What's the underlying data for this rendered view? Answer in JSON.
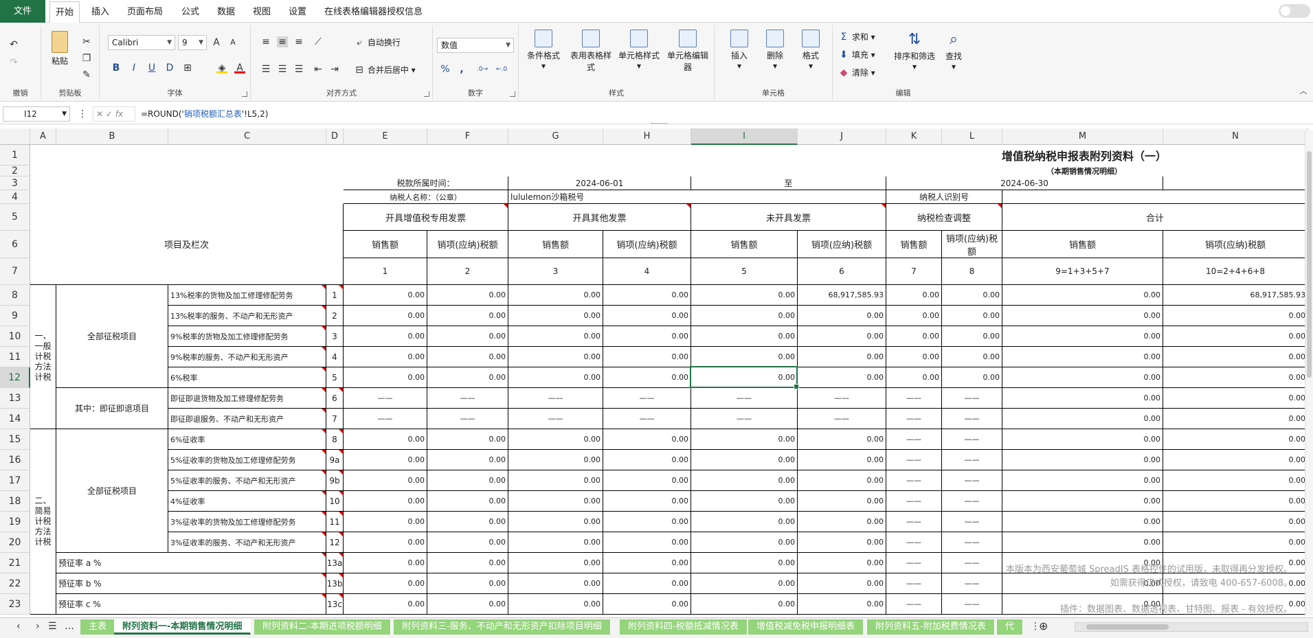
{
  "menu": {
    "file": "文件",
    "items": [
      "开始",
      "插入",
      "页面布局",
      "公式",
      "数据",
      "视图",
      "设置",
      "在线表格编辑器授权信息"
    ]
  },
  "ribbon": {
    "undo_group": "撤销",
    "clipboard": {
      "paste": "粘贴",
      "label": "剪贴板"
    },
    "font": {
      "name": "Calibri",
      "size": "9",
      "label": "字体",
      "bold": "B",
      "italic": "I",
      "underline": "U"
    },
    "align": {
      "wrap": "自动换行",
      "merge": "合并后居中",
      "label": "对齐方式"
    },
    "number": {
      "format": "数值",
      "label": "数字",
      "percent": "%",
      "comma": ","
    },
    "styles": {
      "cond": "条件格式",
      "table": "表用表格样式",
      "cell": "单元格样式",
      "editor": "单元格编辑器",
      "label": "样式"
    },
    "cells": {
      "insert": "插入",
      "delete": "删除",
      "format": "格式",
      "label": "单元格"
    },
    "edit": {
      "sum": "求和",
      "fill": "填充",
      "clear": "清除",
      "sort": "排序和筛选",
      "find": "查找",
      "label": "编辑"
    }
  },
  "formula_bar": {
    "name": "I12",
    "fx": "fx",
    "formula_pre": "=ROUND('",
    "formula_ref": "销项税额汇总表",
    "formula_post": "'!L5,2)"
  },
  "columns": [
    "A",
    "B",
    "C",
    "D",
    "E",
    "F",
    "G",
    "H",
    "I",
    "J",
    "K",
    "L",
    "M",
    "N"
  ],
  "rows": [
    "1",
    "2",
    "3",
    "4",
    "5",
    "6",
    "7",
    "8",
    "9",
    "10",
    "11",
    "12",
    "13",
    "14",
    "15",
    "16",
    "17",
    "18",
    "19",
    "20",
    "21",
    "22",
    "23"
  ],
  "sheet": {
    "title": "增值税纳税申报表附列资料（一）",
    "subtitle": "（本期销售情况明细）",
    "period_label": "税款所属时间：",
    "period_start": "2024-06-01",
    "period_to": "至",
    "period_end": "2024-06-30",
    "taxpayer_label": "纳税人名称：（公章）",
    "taxpayer_name": "lululemon沙箱税号",
    "taxpayer_id_label": "纳税人识别号",
    "items_header": "项目及栏次",
    "h_special": "开具增值税专用发票",
    "h_other": "开具其他发票",
    "h_none": "未开具发票",
    "h_check": "纳税检查调整",
    "h_total": "合计",
    "h_sales": "销售额",
    "h_tax": "销项(应纳)税额",
    "h_tax2": "销项(应纳)税额",
    "h_tax_check": "销项(应纳)税额",
    "c1": "1",
    "c2": "2",
    "c3": "3",
    "c4": "4",
    "c5": "5",
    "c6": "6",
    "c7": "7",
    "c8": "8",
    "c9": "9=1+3+5+7",
    "c10": "10=2+4+6+8",
    "sec1": "一、一般计税方法计税",
    "sec1_all": "全部征税项目",
    "sec1_jz": "其中：即征即退项目",
    "sec2": "二、简易计税方法计税",
    "sec2_all": "全部征税项目",
    "pre_a": "预征率 a %",
    "pre_b": "预征率 b %",
    "pre_c": "预征率 c %"
  },
  "lines": [
    {
      "item": "13%税率的货物及加工修理修配劳务",
      "no": "1",
      "v": [
        "0.00",
        "0.00",
        "0.00",
        "0.00",
        "0.00",
        "68,917,585.93",
        "0.00",
        "0.00",
        "0.00",
        "68,917,585.93"
      ]
    },
    {
      "item": "13%税率的服务、不动产和无形资产",
      "no": "2",
      "v": [
        "0.00",
        "0.00",
        "0.00",
        "0.00",
        "0.00",
        "0.00",
        "0.00",
        "0.00",
        "0.00",
        "0.00"
      ]
    },
    {
      "item": "9%税率的货物及加工修理修配劳务",
      "no": "3",
      "v": [
        "0.00",
        "0.00",
        "0.00",
        "0.00",
        "0.00",
        "0.00",
        "0.00",
        "0.00",
        "0.00",
        "0.00"
      ]
    },
    {
      "item": "9%税率的服务、不动产和无形资产",
      "no": "4",
      "v": [
        "0.00",
        "0.00",
        "0.00",
        "0.00",
        "0.00",
        "0.00",
        "0.00",
        "0.00",
        "0.00",
        "0.00"
      ]
    },
    {
      "item": "6%税率",
      "no": "5",
      "v": [
        "0.00",
        "0.00",
        "0.00",
        "0.00",
        "0.00",
        "0.00",
        "0.00",
        "0.00",
        "0.00",
        "0.00"
      ]
    },
    {
      "item": "即征即退货物及加工修理修配劳务",
      "no": "6",
      "v": [
        "——",
        "——",
        "——",
        "——",
        "——",
        "——",
        "——",
        "——",
        "0.00",
        "0.00"
      ]
    },
    {
      "item": "即征即退服务、不动产和无形资产",
      "no": "7",
      "v": [
        "——",
        "——",
        "——",
        "——",
        "——",
        "——",
        "——",
        "——",
        "0.00",
        "0.00"
      ]
    },
    {
      "item": "6%征收率",
      "no": "8",
      "v": [
        "0.00",
        "0.00",
        "0.00",
        "0.00",
        "0.00",
        "0.00",
        "——",
        "——",
        "0.00",
        "0.00"
      ]
    },
    {
      "item": "5%征收率的货物及加工修理修配劳务",
      "no": "9a",
      "v": [
        "0.00",
        "0.00",
        "0.00",
        "0.00",
        "0.00",
        "0.00",
        "——",
        "——",
        "0.00",
        "0.00"
      ]
    },
    {
      "item": "5%征收率的服务、不动产和无形资产",
      "no": "9b",
      "v": [
        "0.00",
        "0.00",
        "0.00",
        "0.00",
        "0.00",
        "0.00",
        "——",
        "——",
        "0.00",
        "0.00"
      ]
    },
    {
      "item": "4%征收率",
      "no": "10",
      "v": [
        "0.00",
        "0.00",
        "0.00",
        "0.00",
        "0.00",
        "0.00",
        "——",
        "——",
        "0.00",
        "0.00"
      ]
    },
    {
      "item": "3%征收率的货物及加工修理修配劳务",
      "no": "11",
      "v": [
        "0.00",
        "0.00",
        "0.00",
        "0.00",
        "0.00",
        "0.00",
        "——",
        "——",
        "0.00",
        "0.00"
      ]
    },
    {
      "item": "3%征收率的服务、不动产和无形资产",
      "no": "12",
      "v": [
        "0.00",
        "0.00",
        "0.00",
        "0.00",
        "0.00",
        "0.00",
        "——",
        "——",
        "0.00",
        "0.00"
      ]
    },
    {
      "item": "",
      "no": "13a",
      "v": [
        "0.00",
        "0.00",
        "0.00",
        "0.00",
        "0.00",
        "0.00",
        "——",
        "——",
        "0.00",
        "0.00"
      ]
    },
    {
      "item": "",
      "no": "13b",
      "v": [
        "0.00",
        "0.00",
        "0.00",
        "0.00",
        "0.00",
        "0.00",
        "——",
        "——",
        "0.00",
        "0.00"
      ]
    },
    {
      "item": "",
      "no": "13c",
      "v": [
        "0.00",
        "0.00",
        "0.00",
        "0.00",
        "0.00",
        "0.00",
        "——",
        "——",
        "0.00",
        "0.00"
      ]
    }
  ],
  "watermark": {
    "line1": "本版本为西安葡萄城 SpreadJS 表格控件的试用版，未取得再分发授权。",
    "line2": "如需获得正式授权，请致电 400-657-6008。",
    "line3": "插件：数据图表、数据透视表、甘特图、报表 - 有效授权。"
  },
  "tabs": [
    "主表",
    "附列资料一-本期销售情况明细",
    "附列资料二-本期进项税额明细",
    "附列资料三-服务、不动产和无形资产扣除项目明细",
    "附列资料四-税额抵减情况表",
    "增值税减免税申报明细表",
    "附列资料五-附加税费情况表",
    "代"
  ],
  "active_tab": 1,
  "colors": {
    "accent": "#217346",
    "tab": "#94d47a",
    "mark": "#dd0000"
  }
}
